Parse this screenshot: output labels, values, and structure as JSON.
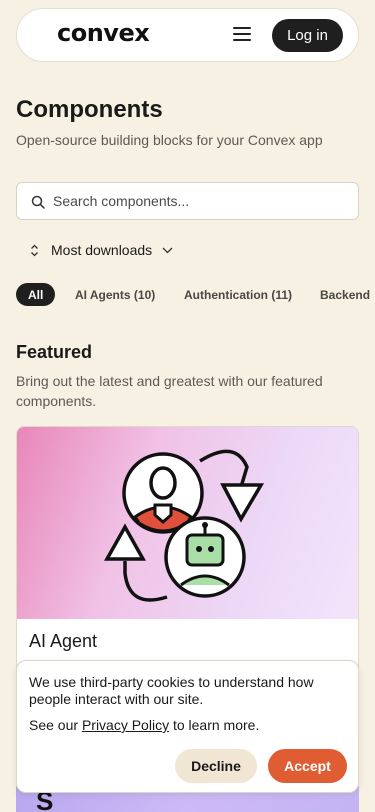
{
  "header": {
    "logo": "convex",
    "menu_icon": "hamburger-menu-icon",
    "login_label": "Log in"
  },
  "page": {
    "title": "Components",
    "subtitle": "Open-source building blocks for your Convex app"
  },
  "search": {
    "placeholder": "Search components...",
    "value": "",
    "icon": "search-icon"
  },
  "sort": {
    "label": "Most downloads",
    "icon": "sort-arrows-icon"
  },
  "tabs": [
    {
      "label": "All",
      "active": true
    },
    {
      "label": "AI Agents (10)",
      "active": false
    },
    {
      "label": "Authentication (11)",
      "active": false
    },
    {
      "label": "Backend",
      "active": false
    }
  ],
  "featured": {
    "title": "Featured",
    "description": "Bring out the latest and greatest with our featured components.",
    "cards": [
      {
        "title": "AI Agent",
        "icon": "ai-agent-illustration"
      },
      {
        "title": "",
        "glyph": "S"
      }
    ]
  },
  "cookie_banner": {
    "text": "We use third-party cookies to understand how people interact with our site.",
    "policy_prefix": "See our ",
    "policy_link": "Privacy Policy",
    "policy_suffix": " to learn more.",
    "decline_label": "Decline",
    "accept_label": "Accept"
  },
  "colors": {
    "background": "#f7f1e4",
    "accent": "#e05d33",
    "dark": "#1f1f1f",
    "decline_bg": "#f1e6d4"
  }
}
